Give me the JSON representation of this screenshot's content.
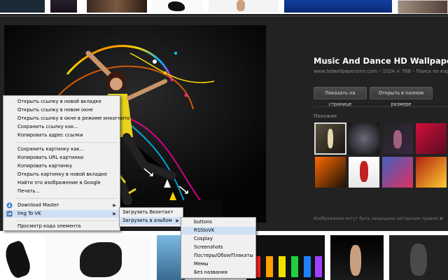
{
  "detail": {
    "title": "Music And Dance HD Wallpapers | HD",
    "source": "www.hdwallpapersinn.com",
    "dimensions": "1024 × 768",
    "search_link": "Поиск по картинке",
    "btn_show": "Показать на странице",
    "btn_full": "Открыть в полном размере",
    "similar_label": "Похожие",
    "copyright": "Изображения могут быть защищены авторским правом.",
    "close_glyph": "✕"
  },
  "context_menu": {
    "items": [
      "Открыть ссылку в новой вкладке",
      "Открыть ссылку в новом окне",
      "Открыть ссылку в окне в режиме инкогнито",
      "Сохранить ссылку как...",
      "Копировать адрес ссылки",
      "Сохранить картинку как...",
      "Копировать URL картинки",
      "Копировать картинку",
      "Открыть картинку в новой вкладке",
      "Найти это изображение в Google",
      "Печать...",
      "Download Master",
      "Img To VK",
      "Просмотр кода элемента"
    ],
    "arrow_glyph": "▶"
  },
  "submenu": {
    "items": [
      "Загрузить Вконтакт",
      "Загрузить в альбом"
    ]
  },
  "albums": {
    "items": [
      "buttons",
      "RSStoVK",
      "Cosplay",
      "Screenshots",
      "Постеры/Обои/Плакаты",
      "Мемы",
      "Без названия"
    ]
  },
  "colors": {
    "menu_highlight": "#cfe0f5",
    "panel_bg": "#222222",
    "dancer_yellow": "#e8d21a"
  }
}
